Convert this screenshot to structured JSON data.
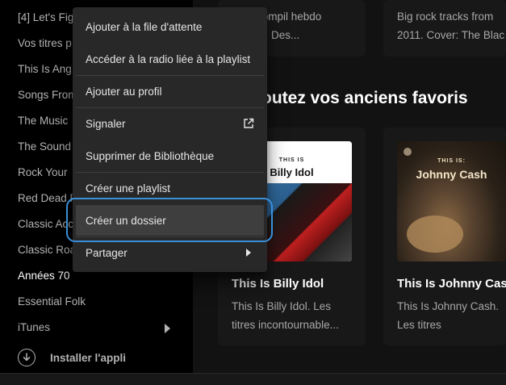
{
  "sidebar": {
    "playlists": [
      "[4] Let's Fig",
      "Vos titres p",
      "This Is Ang",
      "Songs From",
      "The Music",
      "The Sound",
      "Rock Your ",
      "Red Dead R",
      "Classic Acc",
      "Classic Roa",
      "Années 70",
      "Essential Folk",
      "iTunes"
    ],
    "active_index": 10,
    "install_label": "Installer l'appli",
    "install_icon": "download-circle-icon"
  },
  "main": {
    "top_cards": [
      {
        "desc_line1": "compil hebdo",
        "desc_line2": "ts. Des..."
      },
      {
        "desc_line1": "Big rock tracks from",
        "desc_line2": "2011. Cover: The Blac"
      }
    ],
    "section_title": "outez vos anciens favoris",
    "cards": [
      {
        "cover_top_text": "THIS IS",
        "cover_name": "Billy Idol",
        "title": "This Is Billy Idol",
        "desc_line1": "This Is Billy Idol. Les",
        "desc_line2": "titres incontournable..."
      },
      {
        "cover_top_text": "THIS IS:",
        "cover_name": "Johnny Cash",
        "title": "This Is Johnny Cas",
        "desc_line1": "This Is Johnny Cash.",
        "desc_line2": "Les titres"
      }
    ]
  },
  "context_menu": {
    "items": [
      {
        "label": "Ajouter à la file d'attente"
      },
      {
        "label": "Accéder à la radio liée à la playlist"
      },
      {
        "label": "Ajouter au profil"
      },
      {
        "label": "Signaler",
        "icon": "external-link-icon"
      },
      {
        "label": "Supprimer de Bibliothèque"
      },
      {
        "label": "Créer une playlist"
      },
      {
        "label": "Créer un dossier",
        "highlighted": true
      },
      {
        "label": "Partager",
        "icon": "chevron-right-icon"
      }
    ]
  },
  "colors": {
    "focus_ring": "#3a8fd9",
    "menu_bg": "#282828",
    "sidebar_bg": "#000000",
    "main_bg": "#121212"
  }
}
